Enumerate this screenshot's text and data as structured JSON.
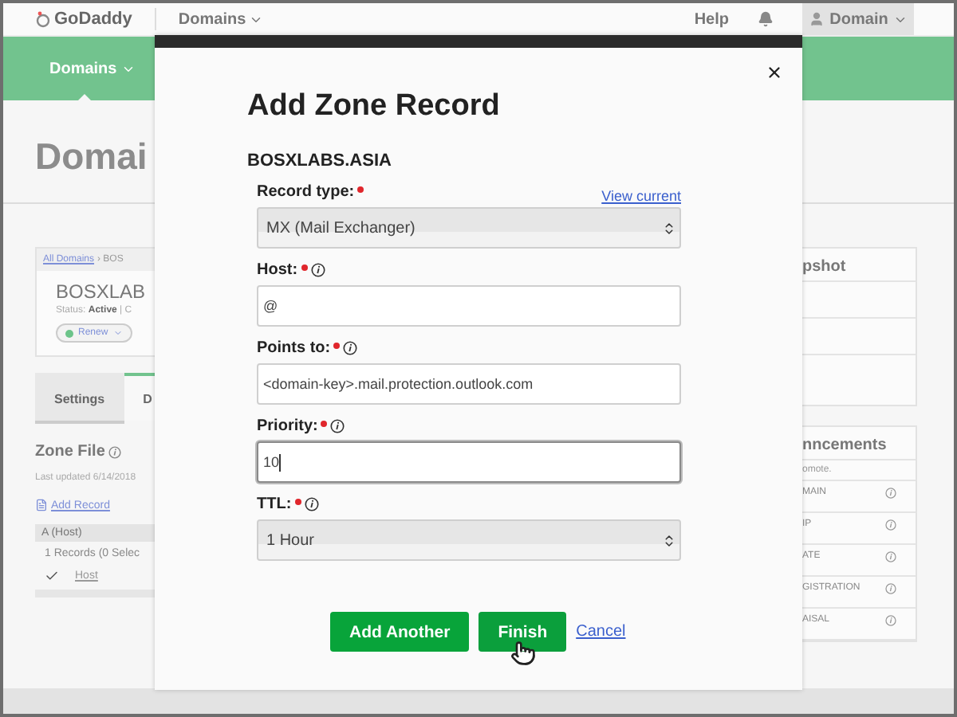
{
  "header": {
    "logo": "GoDaddy",
    "product_menu": "Domains",
    "help": "Help",
    "account": "Domain"
  },
  "nav": {
    "items": [
      {
        "label": "Domains",
        "selected": true
      }
    ]
  },
  "page": {
    "title": "Domai",
    "summary": {
      "breadcrumb_link": "All Domains",
      "breadcrumb_current": "› BOS",
      "domain_name": "BOSXLAB",
      "status_label": "Status:",
      "status_value": "Active",
      "status_more": "| C",
      "renew": "Renew"
    },
    "tabs": [
      {
        "label": "Settings",
        "selected": false
      },
      {
        "label": "D",
        "selected": true
      }
    ],
    "zone_file": {
      "title": "Zone File",
      "last_updated": "Last updated 6/14/2018",
      "add_record": "Add Record",
      "group": "A (Host)",
      "records_count": "1 Records (0 Selec",
      "rows": [
        {
          "host": "Host",
          "checked": true
        }
      ]
    },
    "snapshot": {
      "title": "pshot"
    },
    "announcements": {
      "title": "nncements",
      "note": "omote.",
      "items": [
        "MAIN",
        "IP",
        "ATE",
        "GISTRATION",
        "AISAL"
      ]
    }
  },
  "modal": {
    "title": "Add Zone Record",
    "domain": "BOSXLABS.ASIA",
    "view_current": "View current",
    "fields": [
      {
        "kind": "select",
        "label": "Record type:",
        "required": true,
        "info": false,
        "value": "MX (Mail Exchanger)",
        "focused": false
      },
      {
        "kind": "input",
        "label": "Host:",
        "required": true,
        "info": true,
        "value": "@",
        "focused": false
      },
      {
        "kind": "input",
        "label": "Points to:",
        "required": true,
        "info": true,
        "value": "<domain-key>.mail.protection.outlook.com",
        "focused": false
      },
      {
        "kind": "input",
        "label": "Priority:",
        "required": true,
        "info": true,
        "value": "10",
        "focused": true
      },
      {
        "kind": "select",
        "label": "TTL:",
        "required": true,
        "info": true,
        "value": "1 Hour",
        "focused": false
      }
    ],
    "buttons": [
      {
        "label": "Add Another",
        "hovered": false
      },
      {
        "label": "Finish",
        "hovered": true
      }
    ],
    "cancel": "Cancel"
  }
}
